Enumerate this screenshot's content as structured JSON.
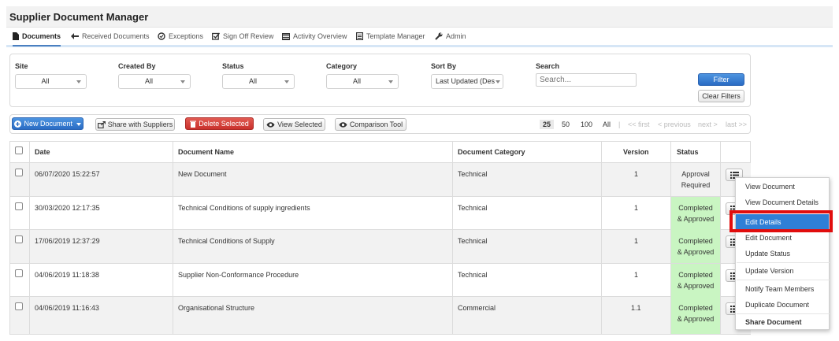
{
  "app": {
    "title": "Supplier Document Manager"
  },
  "nav": [
    {
      "label": "Documents",
      "icon": "file-icon",
      "active": true
    },
    {
      "label": "Received Documents",
      "icon": "arrow-left-icon"
    },
    {
      "label": "Exceptions",
      "icon": "check-circle-icon"
    },
    {
      "label": "Sign Off Review",
      "icon": "check-square-icon"
    },
    {
      "label": "Activity Overview",
      "icon": "list-icon"
    },
    {
      "label": "Template Manager",
      "icon": "template-icon"
    },
    {
      "label": "Admin",
      "icon": "wrench-icon"
    }
  ],
  "filters": {
    "site": {
      "label": "Site",
      "value": "All"
    },
    "created_by": {
      "label": "Created By",
      "value": "All"
    },
    "status": {
      "label": "Status",
      "value": "All"
    },
    "category": {
      "label": "Category",
      "value": "All"
    },
    "sort_by": {
      "label": "Sort By",
      "value": "Last Updated (Desc"
    },
    "search": {
      "label": "Search",
      "placeholder": "Search..."
    },
    "filter_button": "Filter",
    "clear_button": "Clear Filters"
  },
  "toolbar": {
    "new_document": "New Document",
    "share_with_suppliers": "Share with Suppliers",
    "delete_selected": "Delete Selected",
    "view_selected": "View Selected",
    "comparison_tool": "Comparison Tool"
  },
  "pagination": {
    "page_sizes": [
      "25",
      "50",
      "100",
      "All"
    ],
    "selected_page_size": "25",
    "separator": "|",
    "first": "<< first",
    "previous": "< previous",
    "next": "next >",
    "last": "last >>"
  },
  "table": {
    "columns": [
      "Date",
      "Document Name",
      "Document Category",
      "Version",
      "Status"
    ],
    "rows": [
      {
        "date": "06/07/2020 15:22:57",
        "name": "New Document",
        "category": "Technical",
        "version": "1",
        "status_line1": "Approval",
        "status_line2": "Required",
        "status_color": ""
      },
      {
        "date": "30/03/2020 12:17:35",
        "name": "Technical Conditions of supply ingredients",
        "category": "Technical",
        "version": "1",
        "status_line1": "Completed",
        "status_line2": "& Approved",
        "status_color": "#c9f5c2"
      },
      {
        "date": "17/06/2019 12:37:29",
        "name": "Technical Conditions of Supply",
        "category": "Technical",
        "version": "1",
        "status_line1": "Completed",
        "status_line2": "& Approved",
        "status_color": "#c9f5c2"
      },
      {
        "date": "04/06/2019 11:18:38",
        "name": "Supplier Non-Conformance Procedure",
        "category": "Technical",
        "version": "1",
        "status_line1": "Completed",
        "status_line2": "& Approved",
        "status_color": "#c9f5c2"
      },
      {
        "date": "04/06/2019 11:16:43",
        "name": "Organisational Structure",
        "category": "Commercial",
        "version": "1.1",
        "status_line1": "Completed",
        "status_line2": "& Approved",
        "status_color": "#c9f5c2"
      }
    ]
  },
  "context_menu": {
    "items": [
      "View Document",
      "View Document Details",
      "Edit Details",
      "Edit Document",
      "Update Status",
      "Update Version",
      "Notify Team Members",
      "Duplicate Document",
      "Share Document"
    ],
    "highlighted": "Edit Details",
    "highlight_color": "#2f7fd6",
    "annotation_color": "#e10d0d"
  }
}
